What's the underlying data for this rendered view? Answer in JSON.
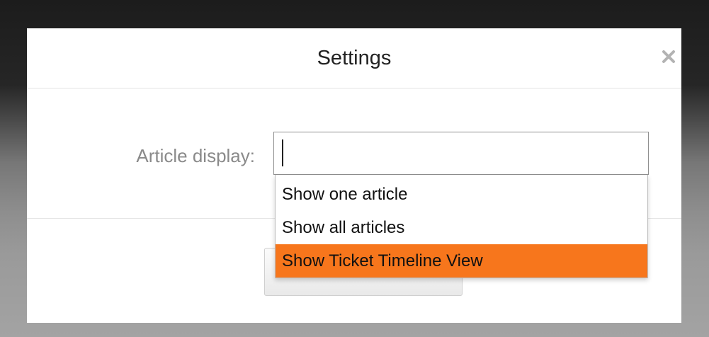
{
  "dialog": {
    "title": "Settings",
    "close_icon": "close-icon"
  },
  "form": {
    "article_display_label": "Article display:",
    "article_display_value": "",
    "options": [
      "Show one article",
      "Show all articles",
      "Show Ticket Timeline View"
    ],
    "highlighted_option": "Show Ticket Timeline View"
  },
  "colors": {
    "highlight": "#f7761c",
    "label": "#8a8a8a"
  }
}
